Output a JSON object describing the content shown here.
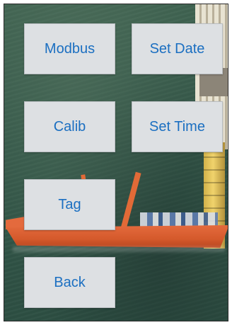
{
  "menu": {
    "modbus_label": "Modbus",
    "set_date_label": "Set Date",
    "calib_label": "Calib",
    "set_time_label": "Set Time",
    "tag_label": "Tag",
    "back_label": "Back"
  },
  "colors": {
    "button_text": "#1b6fc1",
    "button_bg": "#dde0e3",
    "hull": "#e46a3d",
    "sea": "#35594a"
  }
}
